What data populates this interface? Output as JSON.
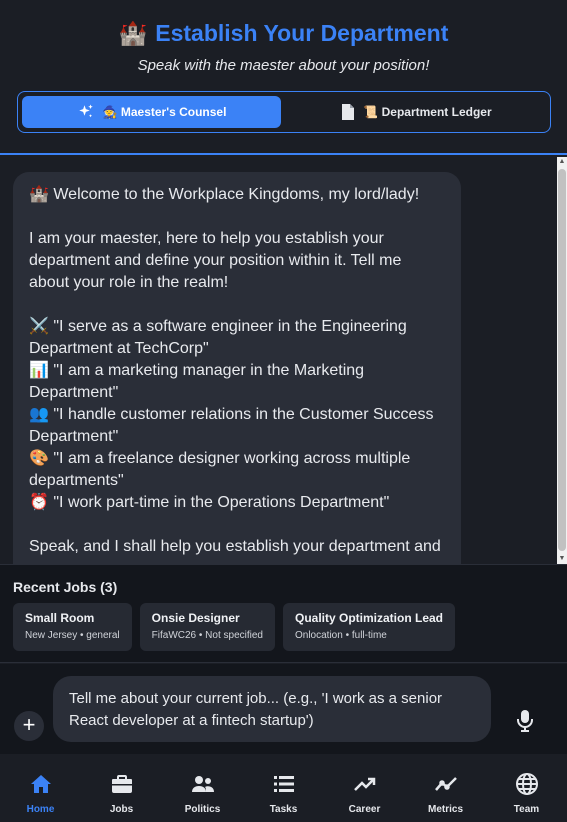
{
  "header": {
    "icon": "castle-icon",
    "title": "Establish Your Department",
    "subtitle": "Speak with the maester about your position!",
    "accent": "#3b82f6"
  },
  "tabs": [
    {
      "label": "🧙 Maester's Counsel",
      "icon": "sparkles-icon",
      "active": true
    },
    {
      "label": "📜 Department Ledger",
      "icon": "document-icon",
      "active": false
    }
  ],
  "message": {
    "text": "🏰 Welcome to the Workplace Kingdoms, my lord/lady!\n\nI am your maester, here to help you establish your department and define your position within it. Tell me about your role in the realm!\n\n⚔️ \"I serve as a software engineer in the Engineering Department at TechCorp\"\n📊 \"I am a marketing manager in the Marketing Department\"\n👥 \"I handle customer relations in the Customer Success Department\"\n🎨 \"I am a freelance designer working across multiple departments\"\n⏰ \"I work part-time in the Operations Department\"\n\nSpeak, and I shall help you establish your department and"
  },
  "recent_jobs": {
    "title": "Recent Jobs (3)",
    "items": [
      {
        "title": "Small Room",
        "meta": "New Jersey • general"
      },
      {
        "title": "Onsie Designer",
        "meta": "FifaWC26 • Not specified"
      },
      {
        "title": "Quality Optimization Lead",
        "meta": "Onlocation • full-time"
      }
    ]
  },
  "composer": {
    "plus": "+",
    "placeholder": "Tell me about your current job... (e.g., 'I work as a senior React developer at a fintech startup')"
  },
  "nav": [
    {
      "label": "Home",
      "icon": "home-icon",
      "active": true
    },
    {
      "label": "Jobs",
      "icon": "briefcase-icon",
      "active": false
    },
    {
      "label": "Politics",
      "icon": "people-icon",
      "active": false
    },
    {
      "label": "Tasks",
      "icon": "list-icon",
      "active": false
    },
    {
      "label": "Career",
      "icon": "trend-up-icon",
      "active": false
    },
    {
      "label": "Metrics",
      "icon": "line-chart-icon",
      "active": false
    },
    {
      "label": "Team",
      "icon": "globe-icon",
      "active": false
    }
  ]
}
